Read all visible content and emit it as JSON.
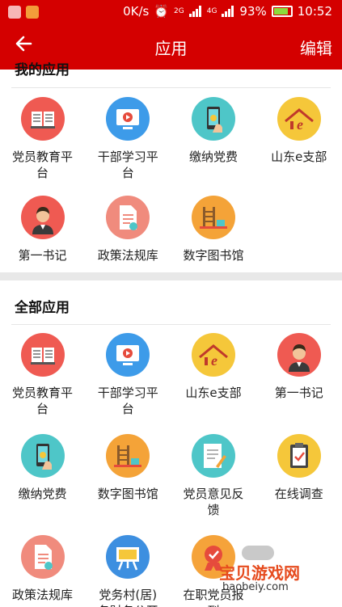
{
  "status_bar": {
    "speed": "0K/s",
    "network_2g": "2G",
    "network_4g": "4G",
    "battery": "93%",
    "time": "10:52"
  },
  "app_bar": {
    "back_icon": "arrow-left-icon",
    "title": "应用",
    "edit": "编辑"
  },
  "my_apps": {
    "title": "我的应用",
    "items": [
      {
        "line1": "党员教育平",
        "line2": "台",
        "icon": "book-icon",
        "color": "#ef5a52"
      },
      {
        "line1": "干部学习平",
        "line2": "台",
        "icon": "video-icon",
        "color": "#3d9be9"
      },
      {
        "line1": "缴纳党费",
        "line2": "",
        "icon": "phone-pay-icon",
        "color": "#4ec6c8"
      },
      {
        "line1": "山东e支部",
        "line2": "",
        "icon": "house-e-icon",
        "color": "#f5c73a"
      },
      {
        "line1": "第一书记",
        "line2": "",
        "icon": "person-icon",
        "color": "#ef5a52"
      },
      {
        "line1": "政策法规库",
        "line2": "",
        "icon": "document-icon",
        "color": "#f08b7d"
      },
      {
        "line1": "数字图书馆",
        "line2": "",
        "icon": "library-icon",
        "color": "#f4a338"
      }
    ]
  },
  "all_apps": {
    "title": "全部应用",
    "items": [
      {
        "line1": "党员教育平",
        "line2": "台",
        "icon": "book-icon",
        "color": "#ef5a52"
      },
      {
        "line1": "干部学习平",
        "line2": "台",
        "icon": "video-icon",
        "color": "#3d9be9"
      },
      {
        "line1": "山东e支部",
        "line2": "",
        "icon": "house-e-icon",
        "color": "#f5c73a"
      },
      {
        "line1": "第一书记",
        "line2": "",
        "icon": "person-icon",
        "color": "#ef5a52"
      },
      {
        "line1": "缴纳党费",
        "line2": "",
        "icon": "phone-pay-icon",
        "color": "#4ec6c8"
      },
      {
        "line1": "数字图书馆",
        "line2": "",
        "icon": "library-icon",
        "color": "#f4a338"
      },
      {
        "line1": "党员意见反",
        "line2": "馈",
        "icon": "notepad-icon",
        "color": "#4ec6c8"
      },
      {
        "line1": "在线调查",
        "line2": "",
        "icon": "clipboard-icon",
        "color": "#f5c73a"
      },
      {
        "line1": "政策法规库",
        "line2": "",
        "icon": "document-icon",
        "color": "#f08b7d"
      },
      {
        "line1": "党务村(居)",
        "line2": "务财务公开",
        "icon": "board-icon",
        "color": "#3d8fe0"
      },
      {
        "line1": "在职党员报",
        "line2": "到",
        "icon": "badge-icon",
        "color": "#f5a33a"
      }
    ]
  },
  "watermark": {
    "text": "宝贝游戏网",
    "url": "baobeiy.com"
  }
}
